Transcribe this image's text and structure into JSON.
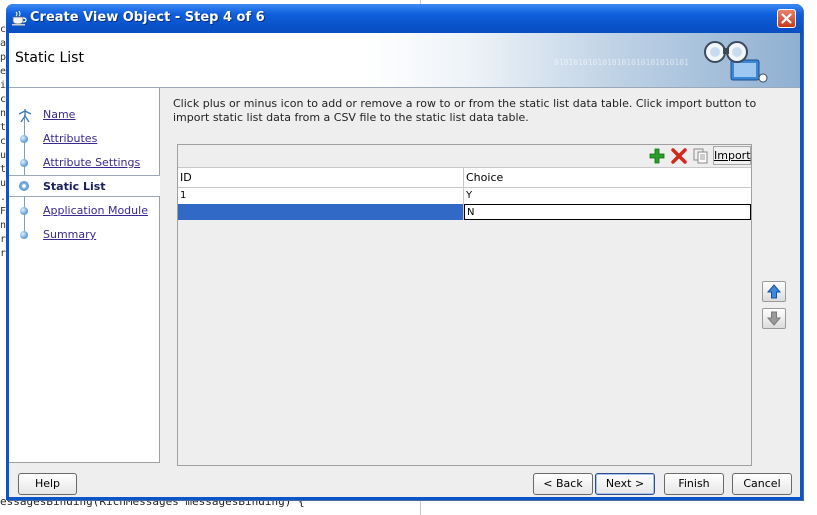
{
  "background": {
    "code_line": "essagesBinding(RichMessages messagesBinding) {",
    "left_chars": [
      "c",
      "a",
      "p",
      "e",
      "i",
      "c",
      "n",
      "t",
      "c",
      "u",
      "t",
      "u",
      ".",
      "F",
      "n",
      "r",
      "r"
    ]
  },
  "dialog": {
    "title": "Create View Object - Step 4 of 6",
    "header_title": "Static List",
    "header_binary": "0101010101010101010101010101",
    "instructions": "Click plus or minus icon to add or remove a row to or from the static list data table. Click import button to import static list data from a CSV file to the static list data table.",
    "steps": [
      {
        "label": "Name",
        "state": "visited"
      },
      {
        "label": "Attributes",
        "state": "visited"
      },
      {
        "label": "Attribute Settings",
        "state": "visited"
      },
      {
        "label": "Static List",
        "state": "active"
      },
      {
        "label": "Application Module",
        "state": "link"
      },
      {
        "label": "Summary",
        "state": "link"
      }
    ],
    "toolbar": {
      "add_icon": "plus-icon",
      "remove_icon": "delete-x-icon",
      "copy_icon": "copy-icon",
      "import_label": "Import"
    },
    "table": {
      "columns": [
        "ID",
        "Choice"
      ],
      "rows": [
        [
          "1",
          "Y"
        ],
        [
          "",
          "N"
        ]
      ],
      "selected_row": 1
    },
    "move_up_icon": "arrow-up-icon",
    "move_down_icon": "arrow-down-icon",
    "buttons": {
      "help": "Help",
      "back": "< Back",
      "next": "Next >",
      "finish": "Finish",
      "cancel": "Cancel"
    },
    "colors": {
      "titlebar": "#0a52c9",
      "selection": "#3169c6",
      "link": "#3a2a90"
    }
  }
}
